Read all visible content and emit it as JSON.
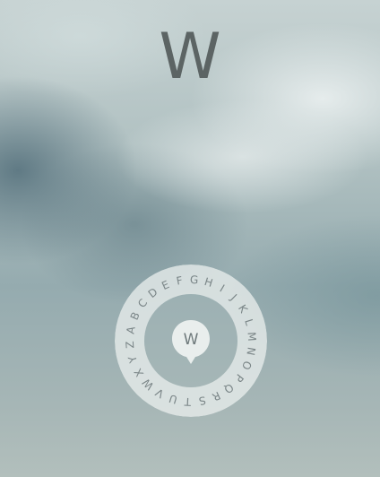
{
  "display": {
    "selected_letter": "W"
  },
  "dial": {
    "letters": [
      "A",
      "B",
      "C",
      "D",
      "E",
      "F",
      "G",
      "H",
      "I",
      "J",
      "K",
      "L",
      "M",
      "N",
      "O",
      "P",
      "Q",
      "R",
      "S",
      "T",
      "U",
      "V",
      "W",
      "X",
      "Y",
      "Z"
    ],
    "center_letter": "W",
    "icon": "location-pin-icon"
  },
  "colors": {
    "letter_display": "#5c6464",
    "dial_ring": "#dfe5e4",
    "dial_text": "#7a8587"
  }
}
